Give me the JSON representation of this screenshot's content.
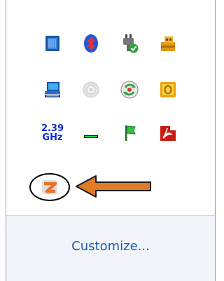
{
  "tray": {
    "icons": [
      {
        "name": "memory-chip-icon"
      },
      {
        "name": "bluetooth-icon"
      },
      {
        "name": "power-plug-icon"
      },
      {
        "name": "usb-device-icon"
      },
      {
        "name": "network-computer-icon"
      },
      {
        "name": "disc-drive-icon"
      },
      {
        "name": "sync-icon"
      },
      {
        "name": "notes-icon"
      },
      {
        "name": "cpu-speed-icon"
      },
      {
        "name": "battery-bar-icon"
      },
      {
        "name": "action-center-flag-icon"
      },
      {
        "name": "acrobat-icon"
      },
      {
        "name": "z-app-icon"
      }
    ],
    "cpu_speed": {
      "value": "2.39",
      "unit": "GHz"
    },
    "annotation_arrow_color": "#e07b28",
    "link_color": "#1e5aa8"
  },
  "customize": {
    "label": "Customize..."
  }
}
